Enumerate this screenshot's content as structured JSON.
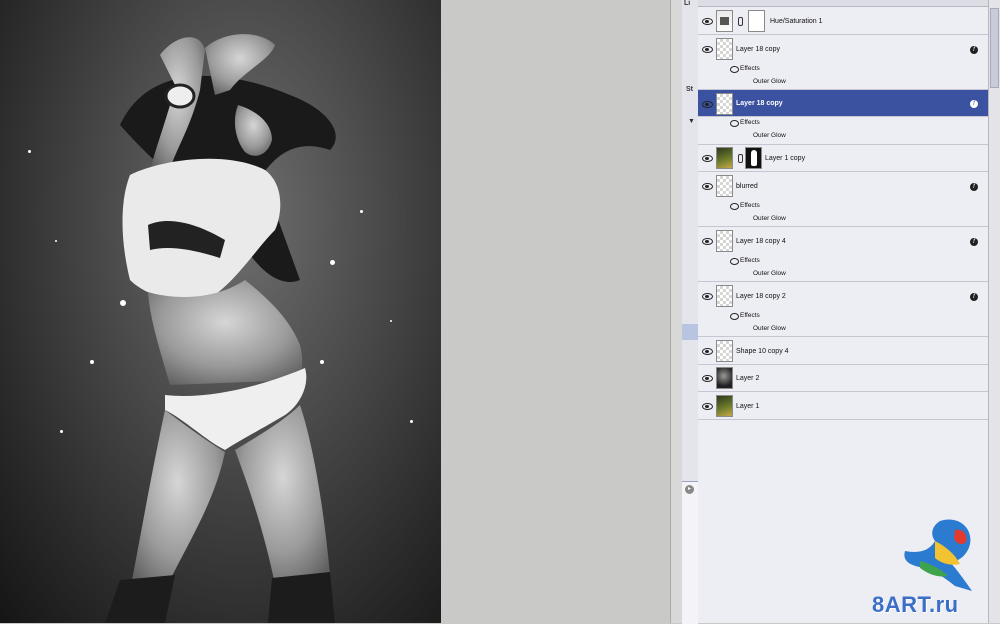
{
  "layers": [
    {
      "name": "Hue/Saturation 1",
      "kind": "adjustment",
      "mask": "white",
      "fx": false,
      "selected": false
    },
    {
      "name": "Layer 18 copy",
      "kind": "empty",
      "fx": true,
      "effects_label": "Effects",
      "effect": "Outer Glow",
      "selected": false
    },
    {
      "name": "Layer 18 copy",
      "kind": "empty",
      "fx": true,
      "effects_label": "Effects",
      "effect": "Outer Glow",
      "selected": true
    },
    {
      "name": "Layer 1 copy",
      "kind": "photo",
      "mask": "figure",
      "fx": false,
      "selected": false
    },
    {
      "name": "blurred",
      "kind": "empty",
      "fx": true,
      "effects_label": "Effects",
      "effect": "Outer Glow",
      "selected": false
    },
    {
      "name": "Layer 18 copy 4",
      "kind": "empty",
      "fx": true,
      "effects_label": "Effects",
      "effect": "Outer Glow",
      "selected": false
    },
    {
      "name": "Layer 18 copy 2",
      "kind": "empty",
      "fx": true,
      "effects_label": "Effects",
      "effect": "Outer Glow",
      "selected": false
    },
    {
      "name": "Shape 10 copy 4",
      "kind": "empty",
      "fx": false,
      "selected": false
    },
    {
      "name": "Layer 2",
      "kind": "dark",
      "fx": false,
      "selected": false
    },
    {
      "name": "Layer 1",
      "kind": "photo",
      "fx": false,
      "selected": false
    }
  ],
  "panel_labels": {
    "top": "Li",
    "side": "St",
    "collapse_arrow": "▼"
  },
  "watermark": "8ART.ru",
  "colors": {
    "selection": "#3a52a0",
    "panel_bg": "#ededf4",
    "watermark": "#3b6fc7"
  },
  "icons": {
    "visibility": "eye-icon",
    "link": "chain-link-icon",
    "effects": "fx-icon"
  }
}
